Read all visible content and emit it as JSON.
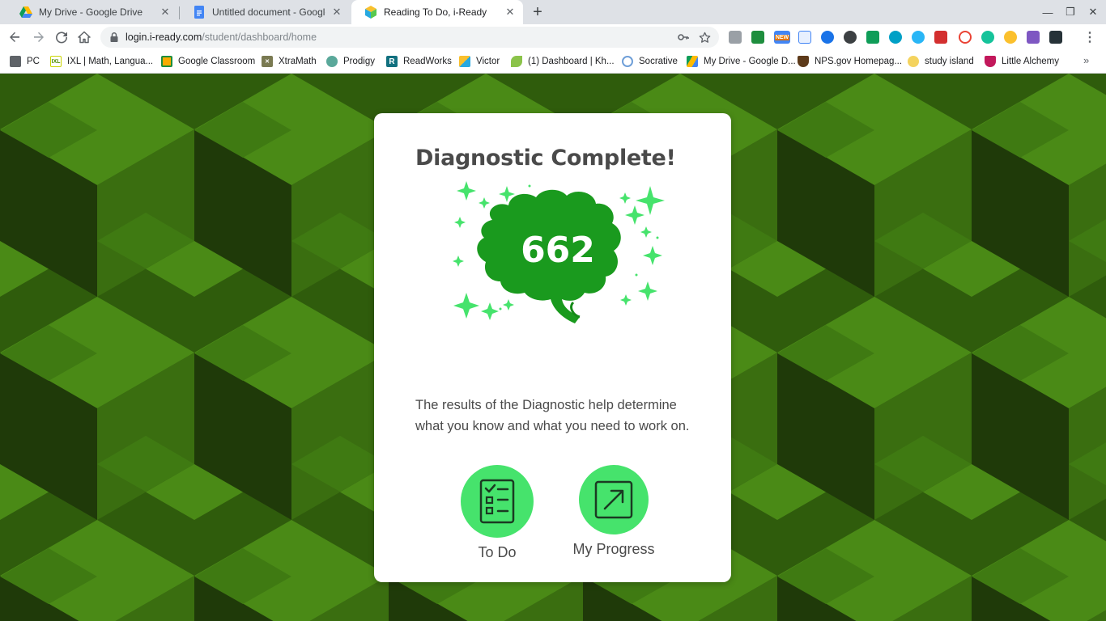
{
  "browser": {
    "tabs": [
      {
        "title": "My Drive - Google Drive",
        "icon": "google-drive-icon"
      },
      {
        "title": "Untitled document - Google Docs",
        "icon": "google-docs-icon"
      },
      {
        "title": "Reading To Do, i-Ready",
        "icon": "iready-icon",
        "active": true
      }
    ],
    "url_host": "login.i-ready.com",
    "url_path": "/student/dashboard/home",
    "bookmarks": [
      {
        "label": "PC",
        "icon": "folder-icon"
      },
      {
        "label": "IXL | Math, Langua...",
        "icon": "ixl-icon"
      },
      {
        "label": "Google Classroom",
        "icon": "google-classroom-icon"
      },
      {
        "label": "XtraMath",
        "icon": "xtramath-icon"
      },
      {
        "label": "Prodigy",
        "icon": "prodigy-icon"
      },
      {
        "label": "ReadWorks",
        "icon": "readworks-icon"
      },
      {
        "label": "Victor",
        "icon": "iready-icon"
      },
      {
        "label": "(1) Dashboard | Kh...",
        "icon": "khan-academy-icon"
      },
      {
        "label": "Socrative",
        "icon": "socrative-icon"
      },
      {
        "label": "My Drive - Google D...",
        "icon": "google-drive-icon"
      },
      {
        "label": "NPS.gov Homepag...",
        "icon": "nps-icon"
      },
      {
        "label": "study island",
        "icon": "study-island-icon"
      },
      {
        "label": "Little Alchemy",
        "icon": "little-alchemy-icon"
      }
    ],
    "extension_badge": "NEW",
    "colors": {
      "tab_strip": "#dee1e6",
      "toolbar": "#ffffff"
    }
  },
  "card": {
    "title": "Diagnostic Complete!",
    "score": "662",
    "description": "The results of the Diagnostic help determine what you know and what you need to work on.",
    "actions": [
      {
        "label": "To Do",
        "icon": "checklist-icon"
      },
      {
        "label": "My Progress",
        "icon": "arrow-up-right-icon"
      }
    ]
  },
  "colors": {
    "background_dark": "#1f3a09",
    "background_mid": "#2f5c0c",
    "background_light": "#3f7a12",
    "brain": "#1a9a1e",
    "sparkle": "#46e36c",
    "action_circle": "#46e36c",
    "text": "#4a4a4a"
  }
}
